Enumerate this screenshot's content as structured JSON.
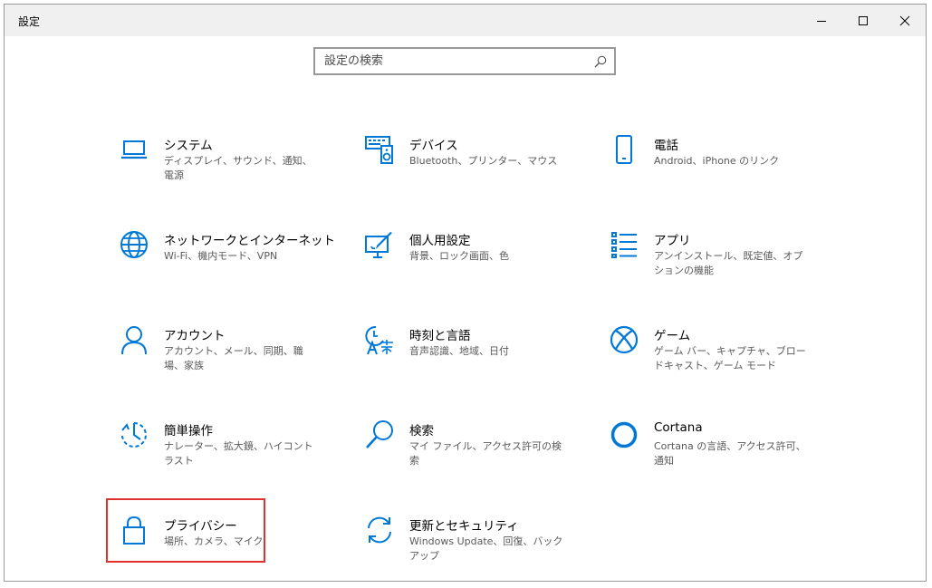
{
  "window": {
    "title": "設定"
  },
  "search": {
    "placeholder": "設定の検索"
  },
  "colors": {
    "accent": "#0078d7",
    "highlight": "#e03030"
  },
  "tiles": [
    {
      "icon": "laptop-icon",
      "title": "システム",
      "desc": "ディスプレイ、サウンド、通知、電源"
    },
    {
      "icon": "keyboard-speaker-icon",
      "title": "デバイス",
      "desc": "Bluetooth、プリンター、マウス"
    },
    {
      "icon": "phone-icon",
      "title": "電話",
      "desc": "Android、iPhone のリンク"
    },
    {
      "icon": "globe-icon",
      "title": "ネットワークとインターネット",
      "desc": "Wi-Fi、機内モード、VPN"
    },
    {
      "icon": "paint-brush-icon",
      "title": "個人用設定",
      "desc": "背景、ロック画面、色"
    },
    {
      "icon": "app-list-icon",
      "title": "アプリ",
      "desc": "アンインストール、既定値、オプションの機能"
    },
    {
      "icon": "person-icon",
      "title": "アカウント",
      "desc": "アカウント、メール、同期、職場、家族"
    },
    {
      "icon": "time-language-icon",
      "title": "時刻と言語",
      "desc": "音声認識、地域、日付"
    },
    {
      "icon": "xbox-icon",
      "title": "ゲーム",
      "desc": "ゲーム バー、キャプチャ、ブロードキャスト、ゲーム モード"
    },
    {
      "icon": "ease-of-access-icon",
      "title": "簡単操作",
      "desc": "ナレーター、拡大鏡、ハイコントラスト"
    },
    {
      "icon": "search-icon",
      "title": "検索",
      "desc": "マイ ファイル、アクセス許可の検索"
    },
    {
      "icon": "cortana-icon",
      "title": "Cortana",
      "desc": "Cortana の言語、アクセス許可、通知"
    },
    {
      "icon": "lock-icon",
      "title": "プライバシー",
      "desc": "場所、カメラ、マイク"
    },
    {
      "icon": "update-icon",
      "title": "更新とセキュリティ",
      "desc": "Windows Update、回復、バック アップ"
    }
  ]
}
